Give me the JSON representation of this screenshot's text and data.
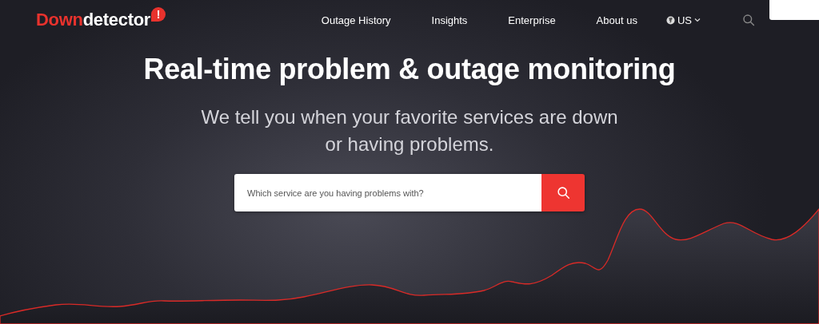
{
  "logo": {
    "text_red": "Down",
    "text_white": "detector",
    "badge": "!"
  },
  "nav": {
    "items": [
      {
        "label": "Outage History"
      },
      {
        "label": "Insights"
      },
      {
        "label": "Enterprise"
      },
      {
        "label": "About us"
      }
    ],
    "region": "US"
  },
  "hero": {
    "title": "Real-time problem & outage monitoring",
    "subtitle": "We tell you when your favorite services are down or having problems."
  },
  "search": {
    "placeholder": "Which service are you having problems with?"
  }
}
